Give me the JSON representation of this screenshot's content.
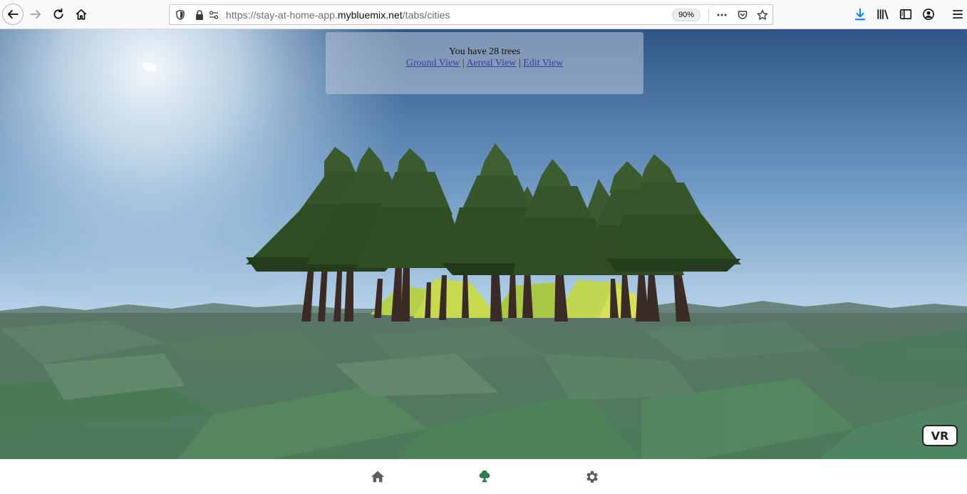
{
  "browser": {
    "url_prefix": "https://stay-at-home-app.",
    "url_domain": "mybluemix.net",
    "url_path": "/tabs/cities",
    "zoom": "90%"
  },
  "scene": {
    "tree_count_text": "You have 28 trees",
    "views": {
      "ground": "Ground View",
      "aereal": "Aereal View",
      "edit": "Edit View",
      "separator": "|"
    },
    "vr_label": "VR"
  },
  "tabs": [
    {
      "icon": "home-icon"
    },
    {
      "icon": "tree-icon",
      "active": true
    },
    {
      "icon": "gear-icon"
    }
  ],
  "colors": {
    "active_tab": "#2e7d4f",
    "inactive_tab": "#5f5f5f",
    "sky_top": "#2f5687",
    "ground": "#4f7a5e",
    "foliage": "#2f4d23"
  }
}
